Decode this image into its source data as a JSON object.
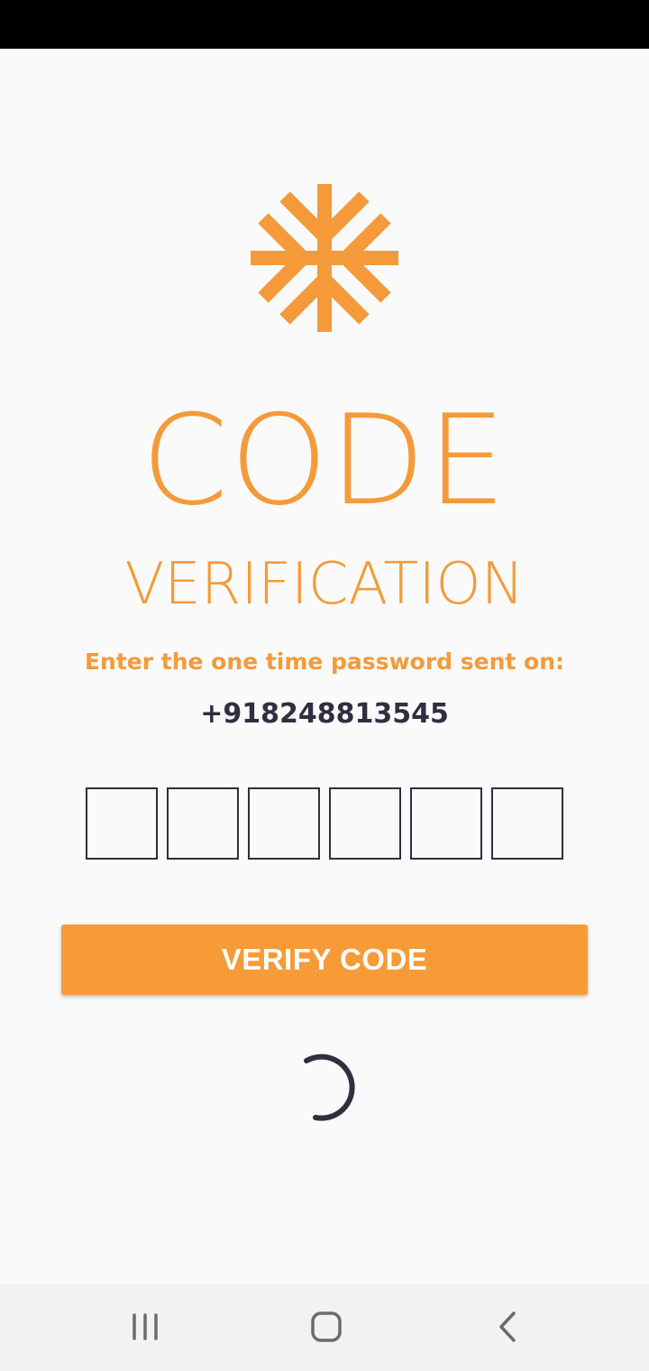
{
  "header": {
    "title_line1": "CODE",
    "title_line2": "VERIFICATION"
  },
  "logo": {
    "icon": "snowflake-asterisk-icon",
    "color": "#f59a3a"
  },
  "instruction": "Enter the one time password sent on:",
  "phone_number": "+918248813545",
  "otp": {
    "digits": [
      "",
      "",
      "",
      "",
      "",
      ""
    ]
  },
  "verify_button": {
    "label": "VERIFY CODE",
    "color": "#f79a38"
  },
  "loading": {
    "icon": "loading-spinner-icon",
    "color": "#2e3040"
  },
  "navigation": {
    "recent_apps": "recent-apps-icon",
    "home": "home-icon",
    "back": "back-icon"
  },
  "colors": {
    "accent": "#f59a3a",
    "text_dark": "#2e3040",
    "background": "#fafafa",
    "status_bar": "#000000",
    "nav_bar": "#f2f2f2"
  }
}
